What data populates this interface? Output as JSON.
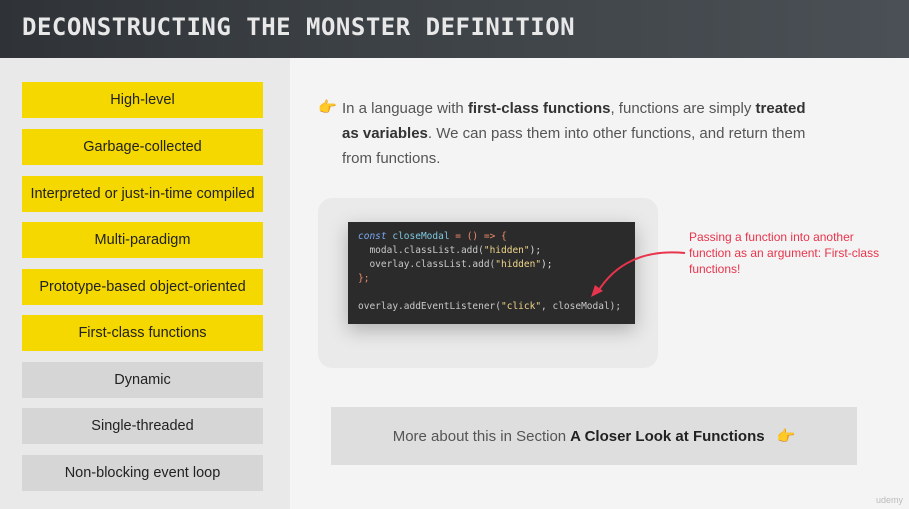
{
  "header": {
    "title": "DECONSTRUCTING THE MONSTER DEFINITION"
  },
  "features": [
    {
      "label": "High-level",
      "highlighted": true
    },
    {
      "label": "Garbage-collected",
      "highlighted": true
    },
    {
      "label": "Interpreted or just-in-time compiled",
      "highlighted": true
    },
    {
      "label": "Multi-paradigm",
      "highlighted": true
    },
    {
      "label": "Prototype-based object-oriented",
      "highlighted": true
    },
    {
      "label": "First-class functions",
      "highlighted": true
    },
    {
      "label": "Dynamic",
      "highlighted": false
    },
    {
      "label": "Single-threaded",
      "highlighted": false
    },
    {
      "label": "Non-blocking event loop",
      "highlighted": false
    }
  ],
  "intro": {
    "icon": "pointing-hand-icon",
    "part1": "In a language with ",
    "bold1": "first-class functions",
    "part2": ", functions are simply ",
    "bold2": "treated as variables",
    "part3": ". We can pass them into other functions, and return them from functions."
  },
  "code": {
    "line1_kw": "const",
    "line1_name": "closeModal",
    "line1_rest": " = () => {",
    "line2": "  modal.classList.add(",
    "line2_str": "\"hidden\"",
    "line3": "  overlay.classList.add(",
    "line3_str": "\"hidden\"",
    "line4": "};",
    "line6_a": "overlay.addEventListener(",
    "line6_str": "\"click\"",
    "line6_b": ", closeModal);"
  },
  "annotation": "Passing a function into another function as an argument: First-class functions!",
  "more": {
    "text": "More about this in Section",
    "bold": "A Closer Look at Functions",
    "icon": "pointing-hand-icon"
  },
  "colors": {
    "highlight": "#f4d800",
    "annotation": "#e8344c",
    "accent_hand": "#f4a623"
  }
}
